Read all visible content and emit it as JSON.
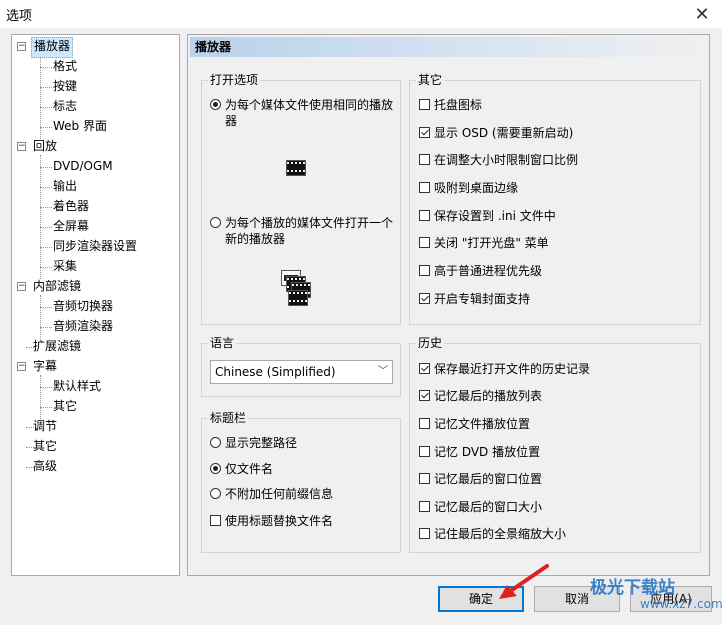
{
  "window": {
    "title": "选项",
    "close_glyph": "✕"
  },
  "tree": {
    "items": [
      {
        "label": "播放器",
        "selected": true
      },
      {
        "label": "格式"
      },
      {
        "label": "按键"
      },
      {
        "label": "标志"
      },
      {
        "label": "Web 界面"
      },
      {
        "label": "回放"
      },
      {
        "label": "DVD/OGM"
      },
      {
        "label": "输出"
      },
      {
        "label": "着色器"
      },
      {
        "label": "全屏幕"
      },
      {
        "label": "同步渲染器设置"
      },
      {
        "label": "采集"
      },
      {
        "label": "内部滤镜"
      },
      {
        "label": "音频切换器"
      },
      {
        "label": "音频渲染器"
      },
      {
        "label": "扩展滤镜"
      },
      {
        "label": "字幕"
      },
      {
        "label": "默认样式"
      },
      {
        "label": "其它"
      },
      {
        "label": "调节"
      },
      {
        "label": "其它"
      },
      {
        "label": "高级"
      }
    ]
  },
  "panel": {
    "header": "播放器",
    "open_options": {
      "label": "打开选项",
      "radio_same_player": "为每个媒体文件使用相同的播放器",
      "radio_same_player_checked": true,
      "radio_new_player": "为每个播放的媒体文件打开一个新的播放器",
      "radio_new_player_checked": false,
      "single_player_icon": "single-player-icon",
      "multi_player_icon": "multi-player-icon"
    },
    "other": {
      "label": "其它",
      "items": [
        {
          "label": "托盘图标",
          "checked": false
        },
        {
          "label": "显示 OSD (需要重新启动)",
          "checked": true
        },
        {
          "label": "在调整大小时限制窗口比例",
          "checked": false
        },
        {
          "label": "吸附到桌面边缘",
          "checked": false
        },
        {
          "label": "保存设置到 .ini 文件中",
          "checked": false
        },
        {
          "label": "关闭 \"打开光盘\" 菜单",
          "checked": false
        },
        {
          "label": "高于普通进程优先级",
          "checked": false
        },
        {
          "label": "开启专辑封面支持",
          "checked": true
        }
      ]
    },
    "language": {
      "label": "语言",
      "value": "Chinese (Simplified)"
    },
    "titlebar": {
      "label": "标题栏",
      "radio_full_path": "显示完整路径",
      "radio_filename_only": "仅文件名",
      "radio_no_prefix": "不附加任何前缀信息",
      "selected": "radio_filename_only",
      "checkbox_use_title": "使用标题替换文件名",
      "checkbox_use_title_checked": false
    },
    "history": {
      "label": "历史",
      "items": [
        {
          "label": "保存最近打开文件的历史记录",
          "checked": true
        },
        {
          "label": "记忆最后的播放列表",
          "checked": true
        },
        {
          "label": "记忆文件播放位置",
          "checked": false
        },
        {
          "label": "记忆 DVD 播放位置",
          "checked": false
        },
        {
          "label": "记忆最后的窗口位置",
          "checked": false
        },
        {
          "label": "记忆最后的窗口大小",
          "checked": false
        },
        {
          "label": "记住最后的全景缩放大小",
          "checked": false
        }
      ]
    }
  },
  "buttons": {
    "ok": "确定",
    "cancel": "取消",
    "apply": "应用(A)"
  },
  "watermark": {
    "brand": "极光下载站",
    "url": "www.xz7.com"
  },
  "colors": {
    "selection": "#cce8ff",
    "default_button_border": "#0078d7",
    "arrow": "#e02020"
  }
}
